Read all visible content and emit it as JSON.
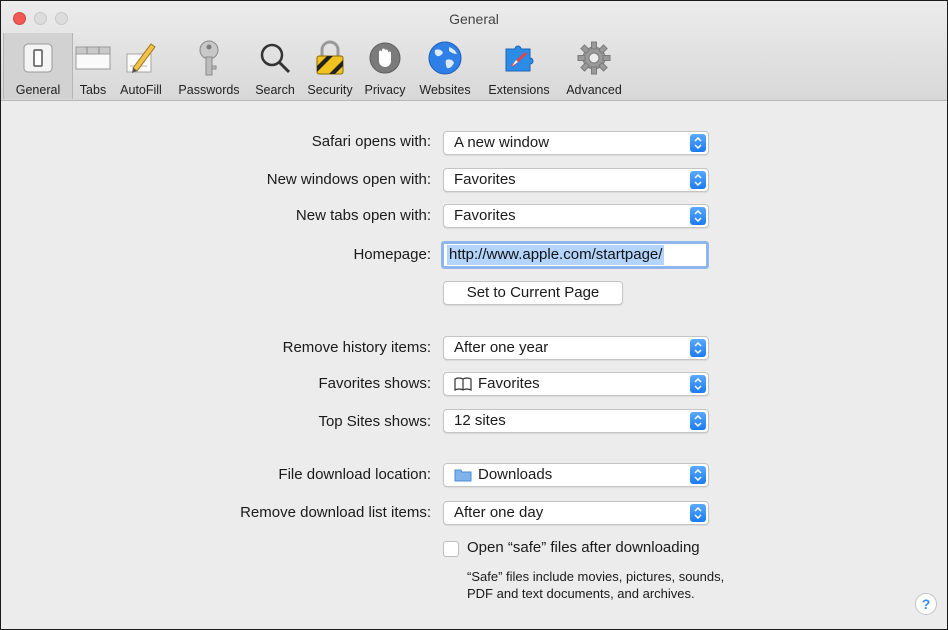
{
  "window": {
    "title": "General"
  },
  "toolbar": {
    "items": [
      {
        "label": "General",
        "icon": "general-switch-icon",
        "active": true
      },
      {
        "label": "Tabs",
        "icon": "tabs-icon"
      },
      {
        "label": "AutoFill",
        "icon": "autofill-pencil-icon"
      },
      {
        "label": "Passwords",
        "icon": "key-icon"
      },
      {
        "label": "Search",
        "icon": "magnifier-icon"
      },
      {
        "label": "Security",
        "icon": "lock-icon"
      },
      {
        "label": "Privacy",
        "icon": "hand-icon"
      },
      {
        "label": "Websites",
        "icon": "globe-icon"
      },
      {
        "label": "Extensions",
        "icon": "puzzle-icon"
      },
      {
        "label": "Advanced",
        "icon": "gear-icon"
      }
    ]
  },
  "settings": {
    "safari_opens_with": {
      "label": "Safari opens with:",
      "value": "A new window"
    },
    "new_windows_open_with": {
      "label": "New windows open with:",
      "value": "Favorites"
    },
    "new_tabs_open_with": {
      "label": "New tabs open with:",
      "value": "Favorites"
    },
    "homepage": {
      "label": "Homepage:",
      "value": "http://www.apple.com/startpage/"
    },
    "set_current_page": {
      "label": "Set to Current Page"
    },
    "remove_history": {
      "label": "Remove history items:",
      "value": "After one year"
    },
    "favorites_shows": {
      "label": "Favorites shows:",
      "value": "Favorites",
      "icon": "book-icon"
    },
    "top_sites_shows": {
      "label": "Top Sites shows:",
      "value": "12 sites"
    },
    "download_location": {
      "label": "File download location:",
      "value": "Downloads",
      "icon": "folder-icon"
    },
    "remove_download_items": {
      "label": "Remove download list items:",
      "value": "After one day"
    },
    "open_safe_files": {
      "label": "Open “safe” files after downloading",
      "checked": false
    },
    "safe_note": "“Safe” files include movies, pictures, sounds, PDF and text documents, and archives."
  },
  "help": {
    "label": "?"
  },
  "colors": {
    "accent": "#1b7bef",
    "close": "#f05a52",
    "selection": "#b3d4fd"
  }
}
